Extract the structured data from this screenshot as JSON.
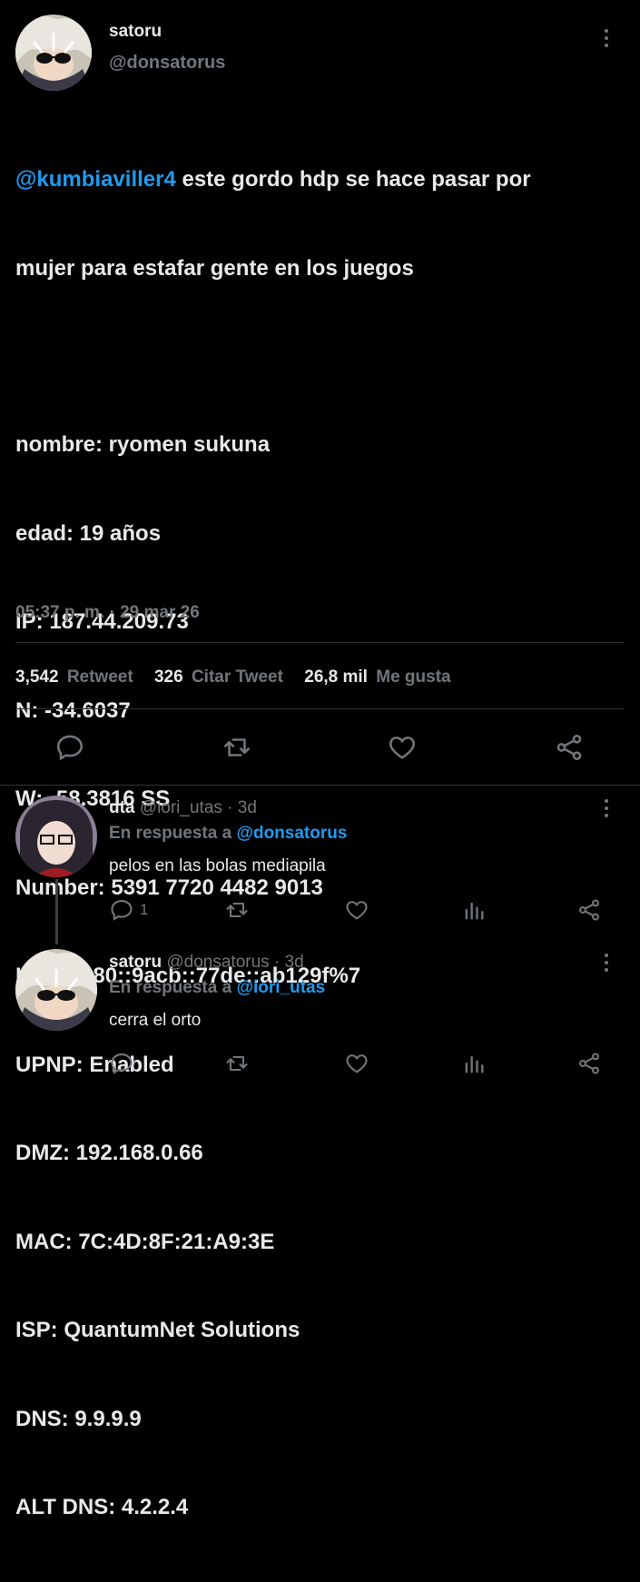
{
  "main_tweet": {
    "display_name": "satoru",
    "handle": "@donsatorus",
    "mention": "@kumbiaviller4",
    "text_line1_rest": " este gordo hdp se hace pasar por",
    "text_line2": "mujer para estafar gente en los juegos",
    "info_lines": [
      "nombre: ryomen sukuna",
      "edad: 19 años",
      "IP: 187.44.209.73",
      "N: -34.6037",
      "W: -58.3816 SS",
      "Number: 5391 7720 4482 9013",
      "IPv6: fe80::9acb::77de::ab129f%7",
      "UPNP: Enabled",
      "DMZ: 192.168.0.66",
      "MAC: 7C:4D:8F:21:A9:3E",
      "ISP: QuantumNet Solutions",
      "DNS: 9.9.9.9",
      "ALT DNS: 4.2.2.4"
    ],
    "timestamp": "05:37 p. m. · 29 mar 26",
    "stats": {
      "retweets_count": "3,542",
      "retweets_label": "Retweet",
      "quotes_count": "326",
      "quotes_label": "Citar Tweet",
      "likes_count": "26,8 mil",
      "likes_label": "Me gusta"
    }
  },
  "replies": [
    {
      "display_name": "uta",
      "handle": "@iori_utas",
      "time": "· 3d",
      "reply_prefix": "En respuesta a",
      "reply_to": "@donsatorus",
      "text": "pelos en las bolas mediapila",
      "reply_count": "1"
    },
    {
      "display_name": "satoru",
      "handle": "@donsatorus",
      "time": "· 3d",
      "reply_prefix": "En respuesta a",
      "reply_to": "@iori_utas",
      "text": "cerra el orto",
      "reply_count": ""
    }
  ],
  "icons": [
    "more-icon",
    "reply-icon",
    "retweet-icon",
    "like-icon",
    "share-icon",
    "analytics-icon"
  ],
  "colors": {
    "background": "#000000",
    "accent": "#1d9bf0",
    "muted": "#71767b",
    "text": "#e7e9ea",
    "divider": "#2f3336"
  }
}
